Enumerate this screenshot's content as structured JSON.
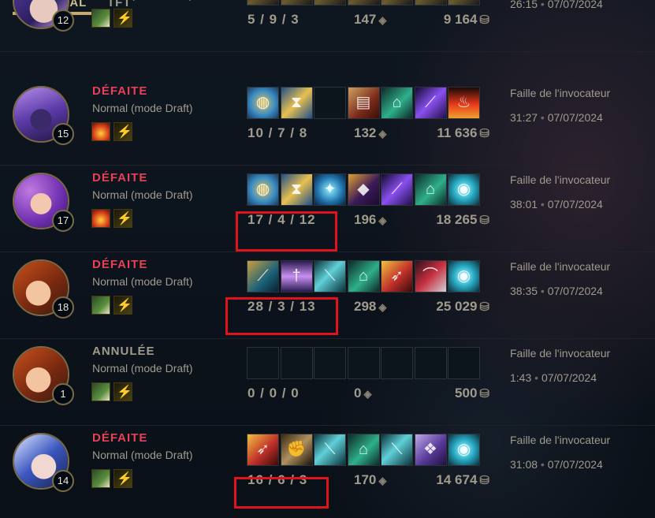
{
  "tabs": {
    "general": "GÉNÉRAL",
    "tft": "TFT"
  },
  "colors": {
    "defeat": "#e84057",
    "cancelled": "#a09b8c",
    "highlight": "#e0121b",
    "tab_underline": "#c8aa6e"
  },
  "matches": [
    {
      "level": "12",
      "result": "",
      "mode": "Normal (mode Draft)",
      "kda": "5 / 9 / 3",
      "cs": "147",
      "gold": "9 164",
      "map": "",
      "duration": "26:15",
      "date": "07/07/2024",
      "spell1": "heal",
      "items": [
        "item",
        "item",
        "item",
        "item",
        "item",
        "item",
        "item"
      ],
      "champion": "purple-hair"
    },
    {
      "level": "15",
      "result": "DÉFAITE",
      "mode": "Normal (mode Draft)",
      "kda": "10 / 7 / 8",
      "cs": "132",
      "gold": "11 636",
      "map": "Faille de l'invocateur",
      "duration": "31:27",
      "date": "07/07/2024",
      "spell1": "ignite",
      "items": [
        "orb",
        "hourglass",
        "empty",
        "tome",
        "boots",
        "staff",
        "torch"
      ],
      "champion": "purple-hood"
    },
    {
      "level": "17",
      "result": "DÉFAITE",
      "mode": "Normal (mode Draft)",
      "kda": "17 / 4 / 12",
      "cs": "196",
      "gold": "18 265",
      "map": "Faille de l'invocateur",
      "duration": "38:01",
      "date": "07/07/2024",
      "spell1": "ignite",
      "items": [
        "orb",
        "hourglass",
        "orb2",
        "mask",
        "staff",
        "boots",
        "sphere"
      ],
      "champion": "violet-girl"
    },
    {
      "level": "18",
      "result": "DÉFAITE",
      "mode": "Normal (mode Draft)",
      "kda": "28 / 3 / 13",
      "cs": "298",
      "gold": "25 029",
      "map": "Faille de l'invocateur",
      "duration": "38:35",
      "date": "07/07/2024",
      "spell1": "heal",
      "items": [
        "blade",
        "sword",
        "dagger",
        "boots",
        "spear",
        "bow",
        "sphere"
      ],
      "champion": "redhead"
    },
    {
      "level": "1",
      "result": "ANNULÉE",
      "mode": "Normal (mode Draft)",
      "kda": "0 / 0 / 0",
      "cs": "0",
      "gold": "500",
      "map": "Faille de l'invocateur",
      "duration": "1:43",
      "date": "07/07/2024",
      "spell1": "heal",
      "items": [
        "empty",
        "empty",
        "empty",
        "empty",
        "empty",
        "empty",
        "empty"
      ],
      "champion": "redhead"
    },
    {
      "level": "14",
      "result": "DÉFAITE",
      "mode": "Normal (mode Draft)",
      "kda": "16 / 6 / 3",
      "cs": "170",
      "gold": "14 674",
      "map": "Faille de l'invocateur",
      "duration": "31:08",
      "date": "07/07/2024",
      "spell1": "heal",
      "items": [
        "spear",
        "gauntlet",
        "dagger",
        "boots",
        "dagger",
        "cloak",
        "sphere"
      ],
      "champion": "blue-hair"
    }
  ]
}
